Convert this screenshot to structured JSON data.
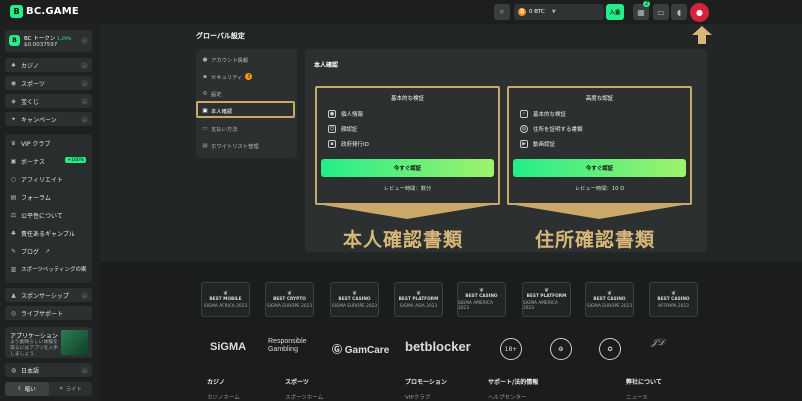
{
  "header": {
    "logo": "BC.GAME",
    "logo_mark": "B",
    "wallet_amount": "0 BTC",
    "deposit_label": "入金",
    "notification_count": "2"
  },
  "sidebar": {
    "token_name": "BC トークン",
    "token_change": "1.29%",
    "token_value": "$0.0037597",
    "sections": [
      {
        "label": "カジノ",
        "icon": "spade-icon"
      },
      {
        "label": "スポーツ",
        "icon": "ball-icon"
      },
      {
        "label": "宝くじ",
        "icon": "ticket-icon"
      },
      {
        "label": "キャンペーン",
        "icon": "gift-icon"
      }
    ],
    "links": [
      {
        "label": "VIP クラブ",
        "icon": "crown-icon"
      },
      {
        "label": "ボーナス",
        "icon": "bonus-icon",
        "badge": "+100%"
      },
      {
        "label": "アフィリエイト",
        "icon": "affiliate-icon"
      },
      {
        "label": "フォーラム",
        "icon": "forum-icon"
      },
      {
        "label": "公平性について",
        "icon": "fairness-icon"
      },
      {
        "label": "責任あるギャンブル",
        "icon": "responsible-icon"
      },
      {
        "label": "ブログ",
        "icon": "blog-icon"
      },
      {
        "label": "スポーツベッティングの案",
        "icon": "sports-guide-icon"
      }
    ],
    "sponsorship": "スポンサーシップ",
    "live_support": "ライブサポート",
    "app_title": "アプリケーション",
    "app_desc": "より素晴らしい体験を得るにはアプリを入手しましょう",
    "language": "日本語",
    "theme_dark": "暗い",
    "theme_light": "ライト"
  },
  "settings": {
    "title": "グローバル設定",
    "menu": [
      {
        "label": "アカウント情報",
        "icon": "user-icon"
      },
      {
        "label": "セキュリティ",
        "icon": "lock-icon",
        "alert": "!"
      },
      {
        "label": "設定",
        "icon": "settings-icon"
      },
      {
        "label": "本人確認",
        "icon": "id-icon"
      },
      {
        "label": "支払い方法",
        "icon": "card-icon"
      },
      {
        "label": "ホワイトリスト管理",
        "icon": "list-icon"
      }
    ]
  },
  "verification": {
    "title": "本人確認",
    "basic": {
      "title": "基本的な検証",
      "items": [
        {
          "label": "個人情報",
          "icon": "person-icon"
        },
        {
          "label": "顔認証",
          "icon": "face-icon"
        },
        {
          "label": "政府発行ID",
          "icon": "id-card-icon"
        }
      ],
      "button": "今すぐ認証",
      "review": "レビュー時間：数分"
    },
    "advanced": {
      "title": "高度な認証",
      "items": [
        {
          "label": "基本的な検証",
          "icon": "check-icon"
        },
        {
          "label": "住所を証明する書類",
          "icon": "globe-icon"
        },
        {
          "label": "動画認証",
          "icon": "video-icon"
        }
      ],
      "button": "今すぐ認証",
      "review": "レビュー時間：10 D"
    },
    "annotation_left": "本人確認書類",
    "annotation_right": "住所確認書類"
  },
  "footer": {
    "awards": [
      {
        "top": "BEST MOBILE",
        "bottom": "SIGMA AFRICA 2023"
      },
      {
        "top": "BEST CRYPTO",
        "bottom": "SIGMA EUROPE 2023"
      },
      {
        "top": "BEST CASINO",
        "bottom": "SIGMA EUROPE 2023"
      },
      {
        "top": "BEST PLATFORM",
        "bottom": "SIGMA ASIA 2023"
      },
      {
        "top": "BEST CASINO",
        "bottom": "SIGMA AMERICA 2023"
      },
      {
        "top": "BEST PLATFORM",
        "bottom": "SIGMA AMERICA 2023"
      },
      {
        "top": "BEST CASINO",
        "bottom": "SIGMA EUROPE 2023"
      },
      {
        "top": "BEST CASINO",
        "bottom": "AFFPAPA 2023"
      }
    ],
    "partners": {
      "sigma": "SiGMA",
      "responsible": "Responsible Gambling",
      "gamcare": "GamCare",
      "betblocker": "betblocker",
      "age": "18+"
    },
    "columns": [
      {
        "title": "カジノ",
        "sub": "カジノホーム"
      },
      {
        "title": "スポーツ",
        "sub": "スポーツホーム"
      },
      {
        "title": "プロモーション",
        "sub": "VIPクラブ"
      },
      {
        "title": "サポート/法的情報",
        "sub": "ヘルプセンター"
      },
      {
        "title": "弊社について",
        "sub": "ニュース"
      }
    ]
  }
}
